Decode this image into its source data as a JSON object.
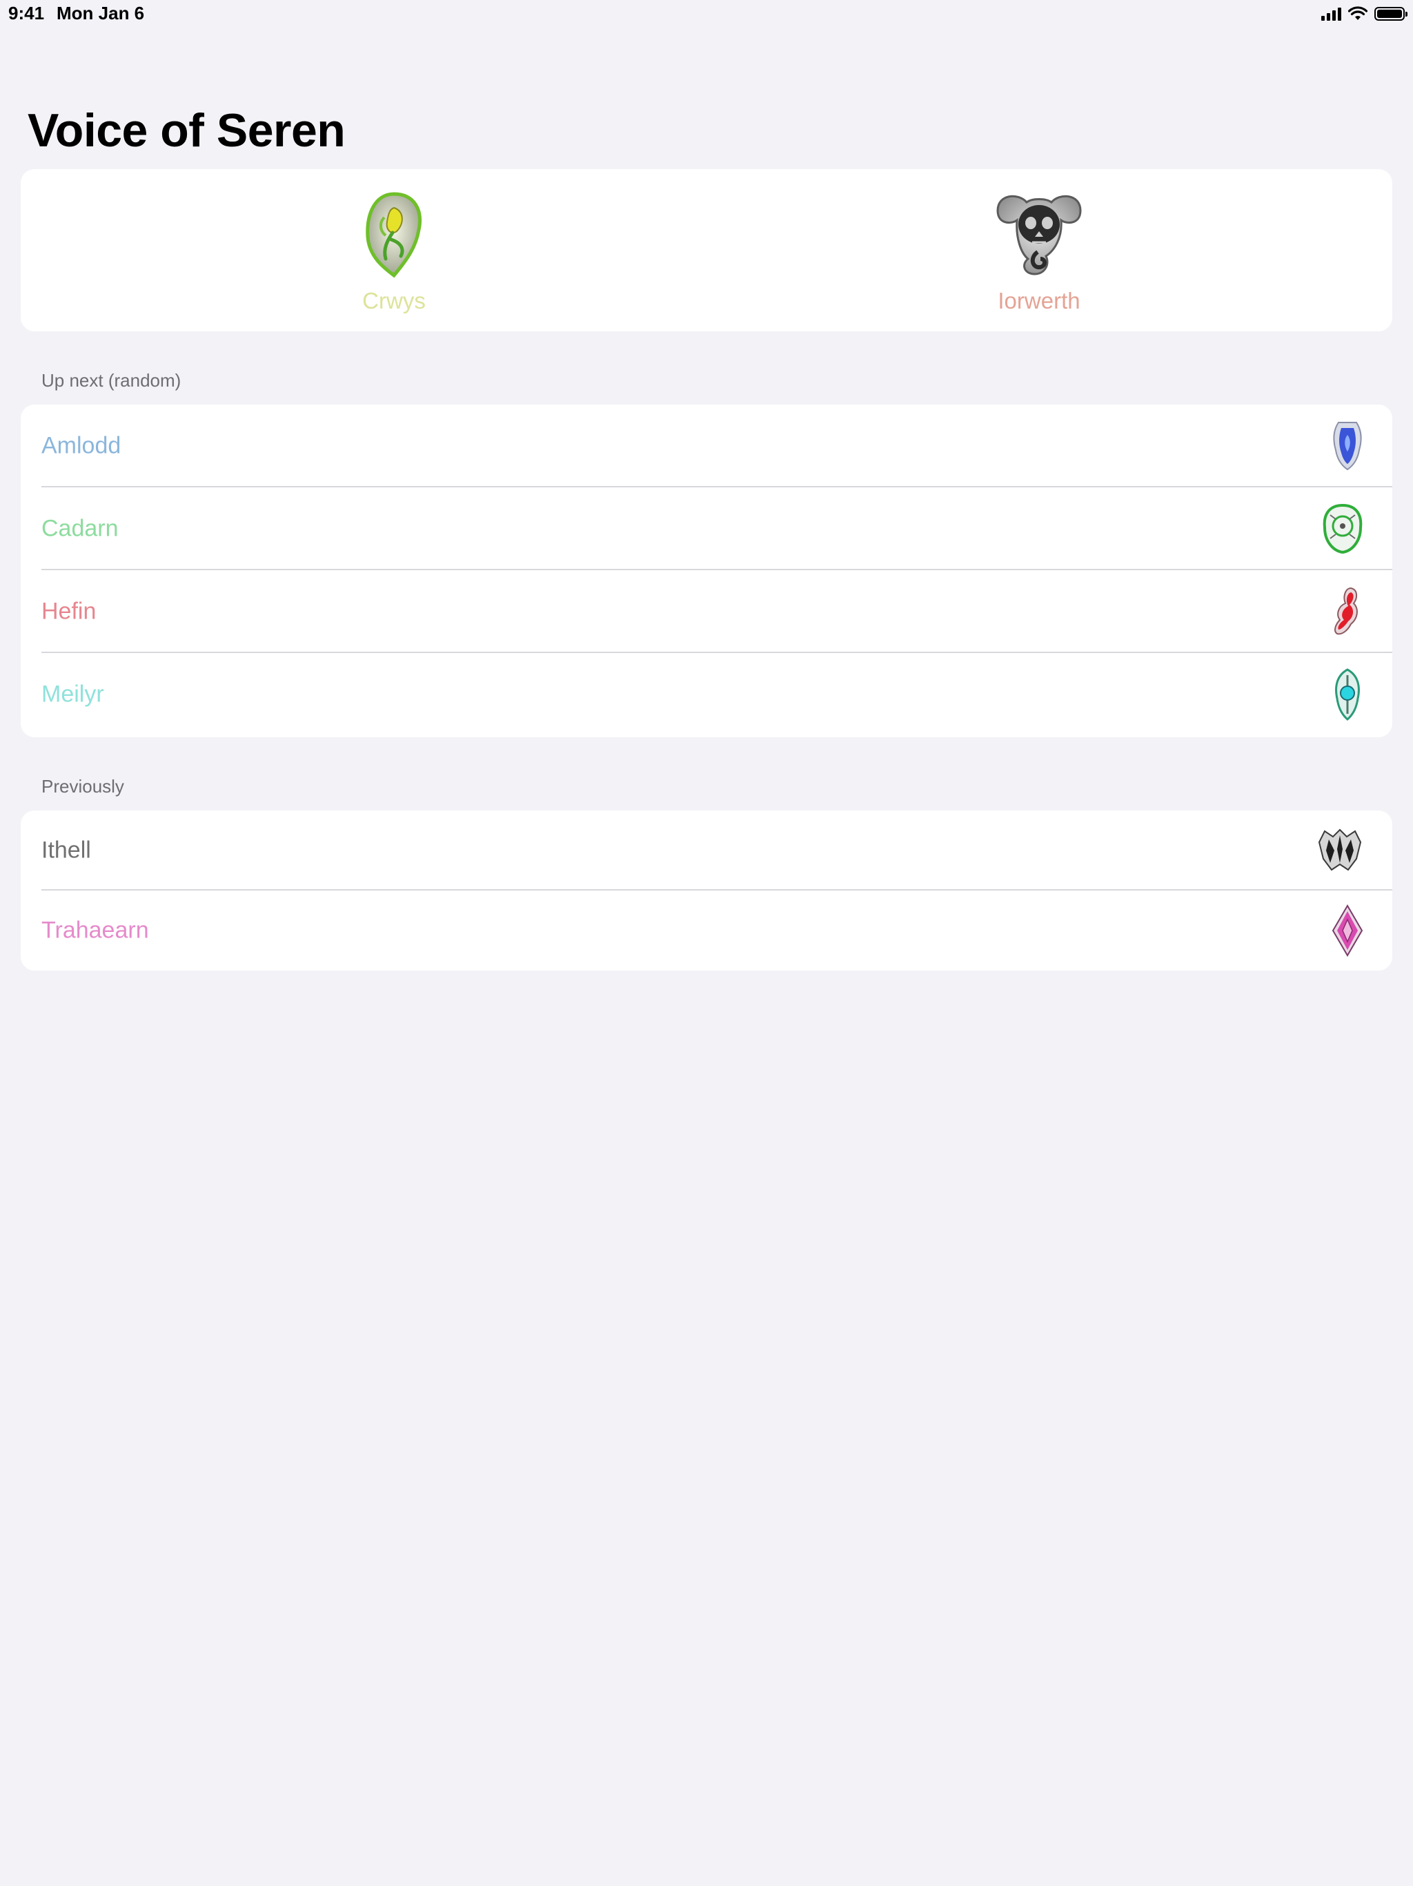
{
  "status_bar": {
    "time": "9:41",
    "date": "Mon Jan 6",
    "icons": [
      "cellular-signal-icon",
      "wifi-icon",
      "battery-icon"
    ]
  },
  "title": "Voice of Seren",
  "current": [
    {
      "name": "Crwys",
      "color": "#dde39a",
      "icon": "crwys-emblem-icon"
    },
    {
      "name": "Iorwerth",
      "color": "#e4a394",
      "icon": "iorwerth-emblem-icon"
    }
  ],
  "up_next": {
    "header": "Up next (random)",
    "items": [
      {
        "name": "Amlodd",
        "color": "#8bb6dc",
        "icon": "amlodd-emblem-icon"
      },
      {
        "name": "Cadarn",
        "color": "#8ddc9e",
        "icon": "cadarn-emblem-icon"
      },
      {
        "name": "Hefin",
        "color": "#e6868f",
        "icon": "hefin-emblem-icon"
      },
      {
        "name": "Meilyr",
        "color": "#8fe2db",
        "icon": "meilyr-emblem-icon"
      }
    ]
  },
  "previously": {
    "header": "Previously",
    "items": [
      {
        "name": "Ithell",
        "color": "#707070",
        "icon": "ithell-emblem-icon"
      },
      {
        "name": "Trahaearn",
        "color": "#e58bcb",
        "icon": "trahaearn-emblem-icon"
      }
    ]
  }
}
